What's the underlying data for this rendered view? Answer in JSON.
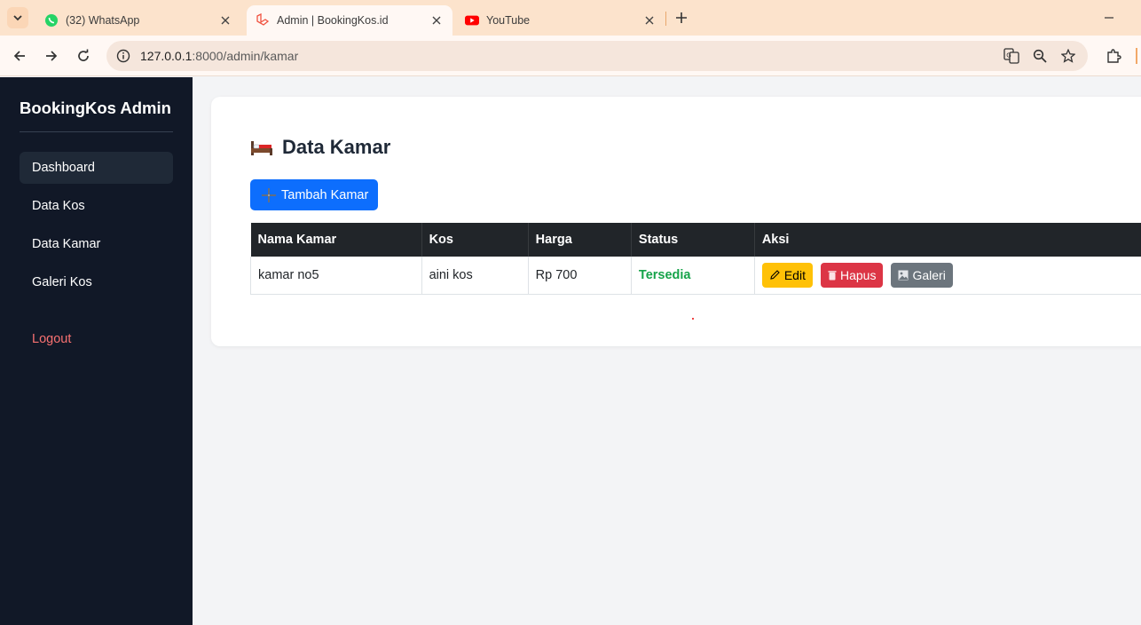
{
  "browser": {
    "tabs": [
      {
        "title": "(32) WhatsApp",
        "icon": "whatsapp-icon",
        "active": false
      },
      {
        "title": "Admin | BookingKos.id",
        "icon": "laravel-icon",
        "active": true
      },
      {
        "title": "YouTube",
        "icon": "youtube-icon",
        "active": false
      }
    ],
    "url_host": "127.0.0.1",
    "url_path": ":8000/admin/kamar"
  },
  "sidebar": {
    "brand": "BookingKos Admin",
    "items": [
      {
        "label": "Dashboard",
        "active": true
      },
      {
        "label": "Data Kos"
      },
      {
        "label": "Data Kamar"
      },
      {
        "label": "Galeri Kos"
      }
    ],
    "logout": "Logout"
  },
  "main": {
    "title": "Data Kamar",
    "add_button": "Tambah Kamar",
    "table": {
      "headers": [
        "Nama Kamar",
        "Kos",
        "Harga",
        "Status",
        "Aksi"
      ],
      "rows": [
        {
          "nama": "kamar no5",
          "kos": "aini kos",
          "harga": "Rp 700",
          "status": "Tersedia",
          "actions": {
            "edit": "Edit",
            "hapus": "Hapus",
            "galeri": "Galeri"
          }
        }
      ]
    }
  },
  "colors": {
    "sidebar_bg": "#111827",
    "primary": "#0d6efd",
    "warning": "#ffc107",
    "danger": "#dc3545",
    "secondary": "#6c757d",
    "success": "#16a34a"
  }
}
